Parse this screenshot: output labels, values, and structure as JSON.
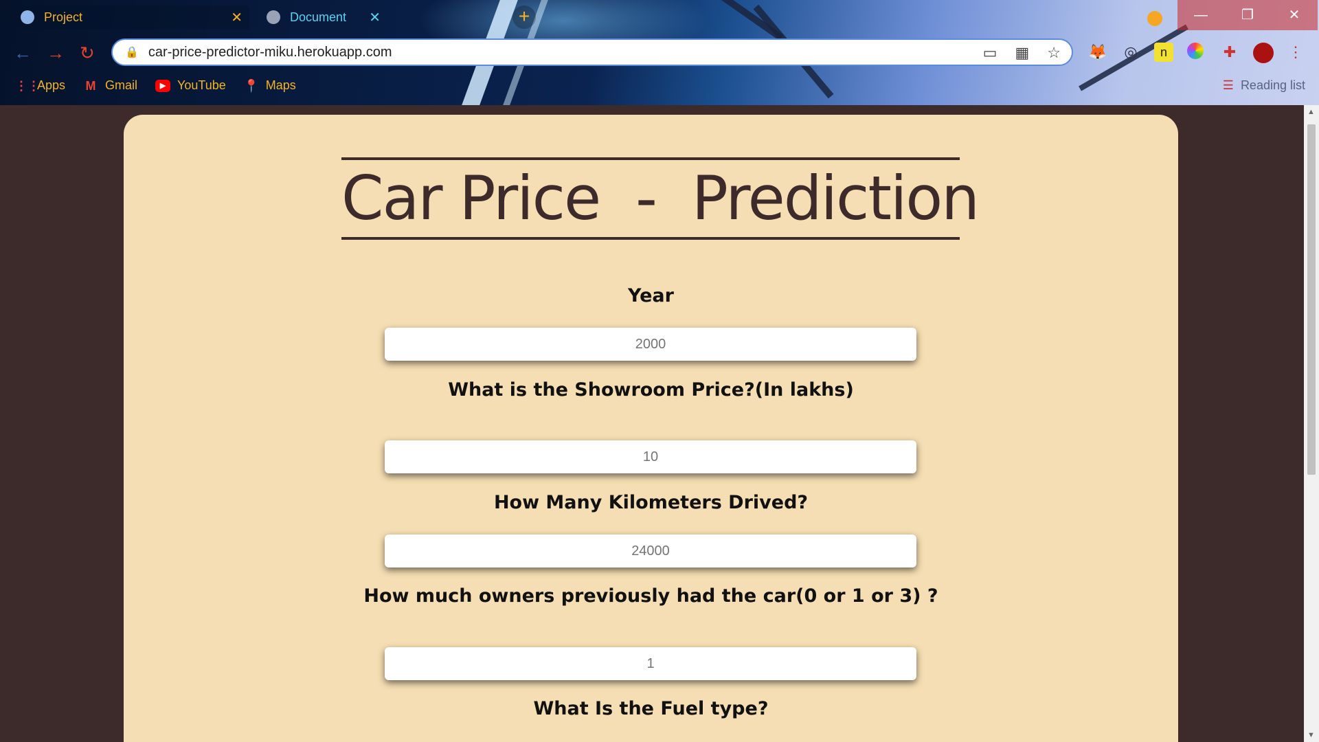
{
  "browser": {
    "tabs": [
      {
        "title": "Project",
        "active": true
      },
      {
        "title": "Document",
        "active": false
      }
    ],
    "address_bar": {
      "url": "car-price-predictor-miku.herokuapp.com"
    },
    "bookmarks": [
      {
        "label": "Apps",
        "icon": "apps-grid-icon"
      },
      {
        "label": "Gmail",
        "icon": "gmail-icon"
      },
      {
        "label": "YouTube",
        "icon": "youtube-icon"
      },
      {
        "label": "Maps",
        "icon": "maps-icon"
      }
    ],
    "reading_list": "Reading list",
    "accent_color": "#f5b323"
  },
  "page": {
    "title": "Car Price  -  Prediction",
    "fields": [
      {
        "label": "Year",
        "placeholder": "2000"
      },
      {
        "label": "What is the Showroom Price?(In lakhs)",
        "placeholder": "10"
      },
      {
        "label": "How Many Kilometers Drived?",
        "placeholder": "24000"
      },
      {
        "label": "How much owners previously had the car(0 or 1 or 3) ?",
        "placeholder": "1"
      },
      {
        "label": "What Is the Fuel type?"
      }
    ],
    "colors": {
      "background": "#3d2b2b",
      "card": "#f5deb3"
    }
  }
}
